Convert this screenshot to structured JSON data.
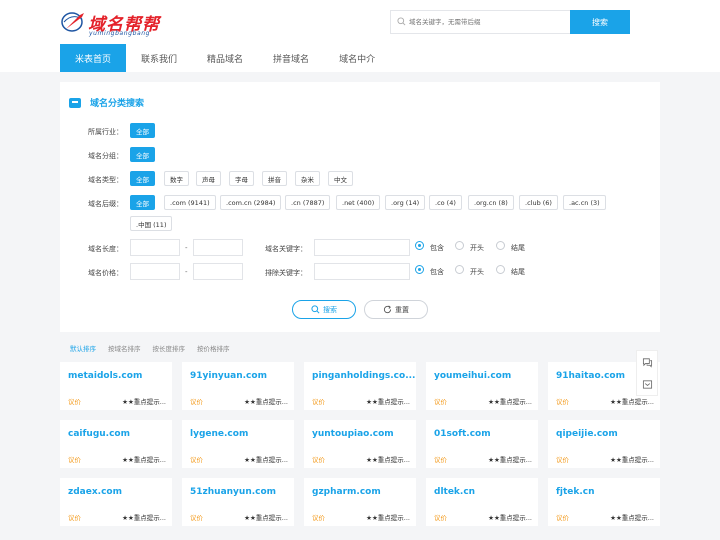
{
  "header": {
    "logo_text": "域名帮帮",
    "logo_sub": "yumingbangbang",
    "search_placeholder": "域名关键字，无需带后缀",
    "search_button": "搜索"
  },
  "nav": {
    "items": [
      "米表首页",
      "联系我们",
      "精品域名",
      "拼音域名",
      "域名中介"
    ]
  },
  "filter": {
    "title": "域名分类搜索",
    "industry_label": "所属行业：",
    "industry_all": "全部",
    "group_label": "域名分组：",
    "group_all": "全部",
    "type_label": "域名类型：",
    "types": [
      "全部",
      "数字",
      "声母",
      "字母",
      "拼音",
      "杂米",
      "中文"
    ],
    "suffix_label": "域名后缀：",
    "suffixes": [
      "全部",
      ".com (9141)",
      ".com.cn (2984)",
      ".cn (7887)",
      ".net (400)",
      ".org (14)",
      ".co (4)",
      ".org.cn (8)",
      ".club (6)",
      ".ac.cn (3)",
      ".中国 (11)"
    ],
    "length_label": "域名长度：",
    "price_label": "域名价格：",
    "dash": "-",
    "keyword_label": "域名关键字：",
    "exclude_label": "排除关键字：",
    "radio_options": [
      "包含",
      "开头",
      "结尾"
    ],
    "search_button": "搜索",
    "reset_button": "重置"
  },
  "sort": {
    "items": [
      "默认排序",
      "按域名排序",
      "按长度排序",
      "按价格排序"
    ]
  },
  "cards": [
    {
      "domain": "metaidols.com",
      "price": "议价",
      "note": "★★重点提示..."
    },
    {
      "domain": "91yinyuan.com",
      "price": "议价",
      "note": "★★重点提示..."
    },
    {
      "domain": "pinganholdings.co...",
      "price": "议价",
      "note": "★★重点提示..."
    },
    {
      "domain": "youmeihui.com",
      "price": "议价",
      "note": "★★重点提示..."
    },
    {
      "domain": "91haitao.com",
      "price": "议价",
      "note": "★★重点提示..."
    },
    {
      "domain": "caifugu.com",
      "price": "议价",
      "note": "★★重点提示..."
    },
    {
      "domain": "lygene.com",
      "price": "议价",
      "note": "★★重点提示..."
    },
    {
      "domain": "yuntoupiao.com",
      "price": "议价",
      "note": "★★重点提示..."
    },
    {
      "domain": "01soft.com",
      "price": "议价",
      "note": "★★重点提示..."
    },
    {
      "domain": "qipeijie.com",
      "price": "议价",
      "note": "★★重点提示..."
    },
    {
      "domain": "zdaex.com",
      "price": "议价",
      "note": "★★重点提示..."
    },
    {
      "domain": "51zhuanyun.com",
      "price": "议价",
      "note": "★★重点提示..."
    },
    {
      "domain": "gzpharm.com",
      "price": "议价",
      "note": "★★重点提示..."
    },
    {
      "domain": "dltek.cn",
      "price": "议价",
      "note": "★★重点提示..."
    },
    {
      "domain": "fjtek.cn",
      "price": "议价",
      "note": "★★重点提示..."
    }
  ],
  "colors": {
    "accent": "#1aa3e8",
    "price": "#f39a1c",
    "logo": "#e4222a"
  },
  "icons": {
    "float": [
      "chat-icon",
      "message-icon"
    ]
  }
}
